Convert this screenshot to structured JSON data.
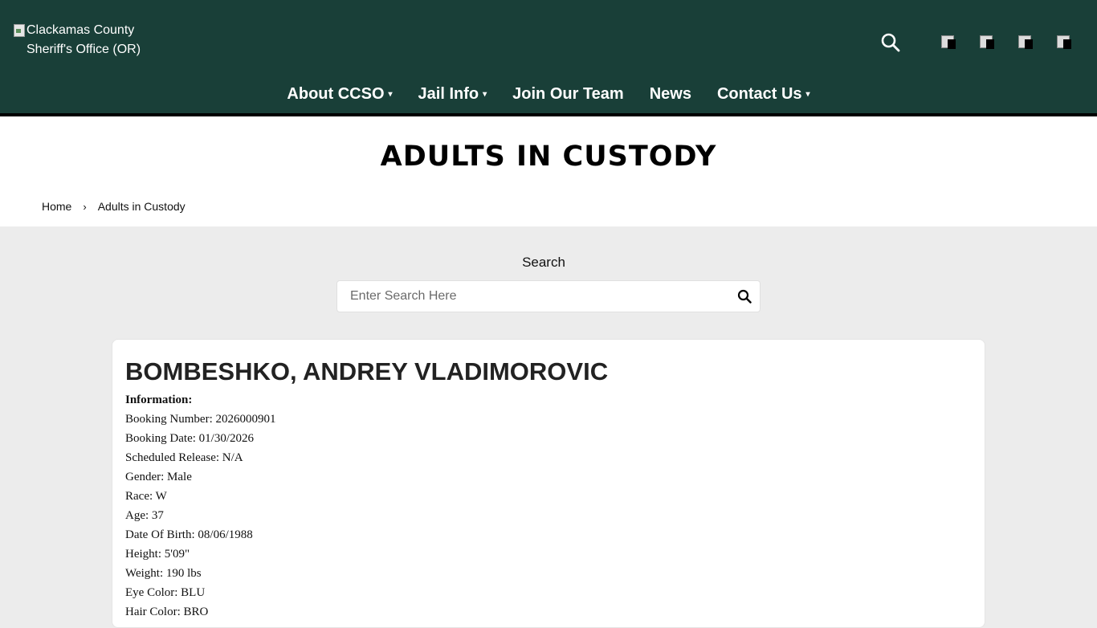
{
  "header": {
    "logo_alt": "Clackamas County Sheriff's Office (OR)",
    "nav": [
      {
        "label": "About CCSO",
        "dropdown": true
      },
      {
        "label": "Jail Info",
        "dropdown": true
      },
      {
        "label": "Join Our Team",
        "dropdown": false
      },
      {
        "label": "News",
        "dropdown": false
      },
      {
        "label": "Contact Us",
        "dropdown": true
      }
    ],
    "caret": "▾",
    "icons": [
      "search-icon",
      "social-icon-1",
      "social-icon-2",
      "social-icon-3",
      "social-icon-4"
    ]
  },
  "page": {
    "title": "ADULTS IN CUSTODY",
    "breadcrumb": {
      "home": "Home",
      "separator": "›",
      "current": "Adults in Custody"
    }
  },
  "search": {
    "label": "Search",
    "placeholder": "Enter Search Here"
  },
  "inmate": {
    "name": "BOMBESHKO, ANDREY VLADIMOROVIC",
    "info_heading": "Information:",
    "fields": [
      "Booking Number: 2026000901",
      "Booking Date: 01/30/2026",
      "Scheduled Release: N/A",
      "Gender: Male",
      "Race: W",
      "Age: 37",
      "Date Of Birth: 08/06/1988",
      "Height: 5'09\"",
      "Weight: 190 lbs",
      "Eye Color: BLU",
      "Hair Color: BRO"
    ]
  },
  "colors": {
    "header_bg": "#193f38",
    "page_bg": "#ececec",
    "card_bg": "#ffffff"
  }
}
